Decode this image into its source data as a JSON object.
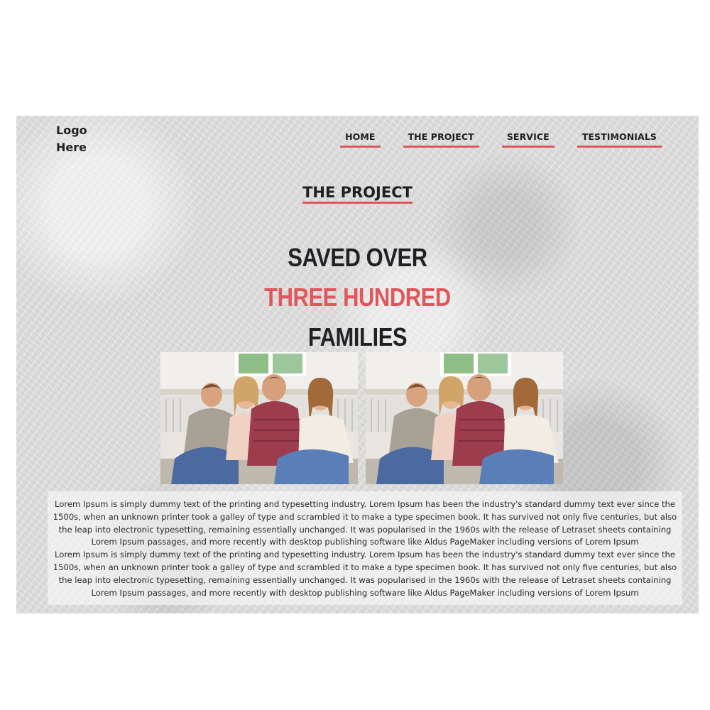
{
  "header": {
    "logo": "Logo Here",
    "nav": [
      {
        "label": "HOME"
      },
      {
        "label": "THE PROJECT"
      },
      {
        "label": "SERVICE"
      },
      {
        "label": "TESTIMONIALS"
      }
    ]
  },
  "section": {
    "title": "THE PROJECT"
  },
  "headline": {
    "line1": "SAVED OVER",
    "line2": "THREE HUNDRED",
    "line3": "FAMILIES"
  },
  "photos": [
    {
      "icon": "family-photo"
    },
    {
      "icon": "family-photo"
    }
  ],
  "body": {
    "paragraphs": [
      "Lorem Ipsum is simply dummy text of the printing and typesetting industry. Lorem Ipsum has been the industry's standard dummy text ever since the 1500s, when an unknown printer took a galley of type and scrambled it to make a type specimen book. It has survived not only five centuries, but also the leap into electronic typesetting, remaining essentially unchanged. It was popularised in the 1960s with the release of Letraset sheets containing Lorem Ipsum passages, and more recently with desktop publishing software like Aldus PageMaker including versions of Lorem Ipsum",
      "Lorem Ipsum is simply dummy text of the printing and typesetting industry. Lorem Ipsum has been the industry's standard dummy text ever since the 1500s, when an unknown printer took a galley of type and scrambled it to make a type specimen book. It has survived not only five centuries, but also the leap into electronic typesetting, remaining essentially unchanged. It was popularised in the 1960s with the release of Letraset sheets containing Lorem Ipsum passages, and more recently with desktop publishing software like Aldus PageMaker including versions of Lorem Ipsum"
    ]
  },
  "colors": {
    "accent": "#e0565b",
    "text": "#1f2124"
  }
}
